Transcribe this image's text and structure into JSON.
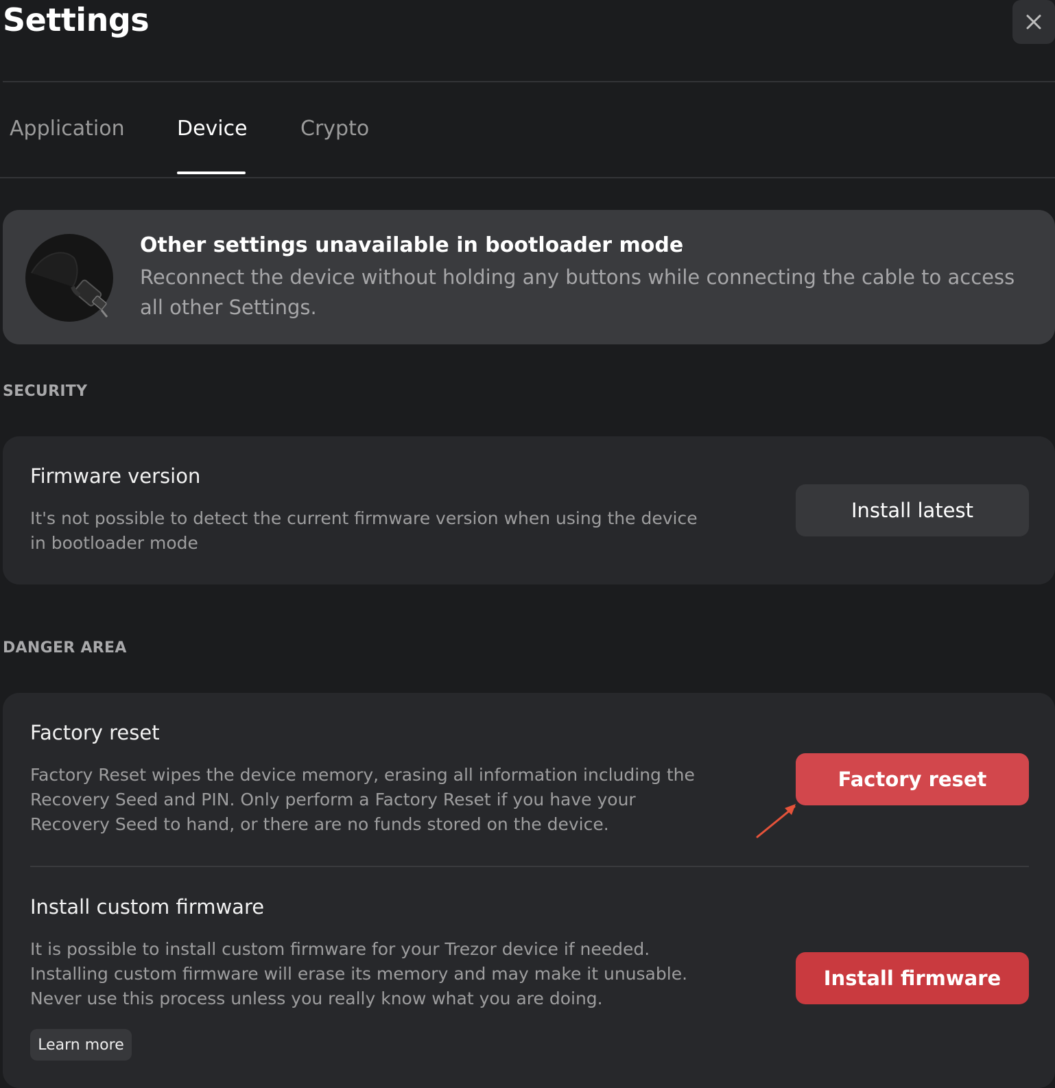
{
  "window": {
    "title": "Settings"
  },
  "tabs": [
    {
      "label": "Application"
    },
    {
      "label": "Device"
    },
    {
      "label": "Crypto"
    }
  ],
  "banner": {
    "title": "Other settings unavailable in bootloader mode",
    "text": "Reconnect the device without holding any buttons while connecting the cable to access all other Settings."
  },
  "sections": {
    "security": {
      "label": "SECURITY",
      "firmware": {
        "title": "Firmware version",
        "description": "It's not possible to detect the current firmware version when using the device in bootloader mode",
        "button": "Install latest"
      }
    },
    "danger": {
      "label": "DANGER AREA",
      "factory_reset": {
        "title": "Factory reset",
        "description": "Factory Reset wipes the device memory, erasing all information including the Recovery Seed and PIN. Only perform a Factory Reset if you have your Recovery Seed to hand, or there are no funds stored on the device.",
        "button": "Factory reset"
      },
      "custom_firmware": {
        "title": "Install custom firmware",
        "description": "It is possible to install custom firmware for your Trezor device if needed. Installing custom firmware will erase its memory and may make it unusable. Never use this process unless you really know what you are doing.",
        "button": "Install firmware",
        "learn_more": "Learn more"
      }
    }
  },
  "icons": {
    "close": "close-icon",
    "device": "usb-cable-icon",
    "annotation": "arrow-annotation-icon"
  },
  "colors": {
    "background": "#1b1c1e",
    "card": "#27282b",
    "banner": "#3a3b3e",
    "danger": "#d2474c",
    "annotation": "#e5533a"
  }
}
